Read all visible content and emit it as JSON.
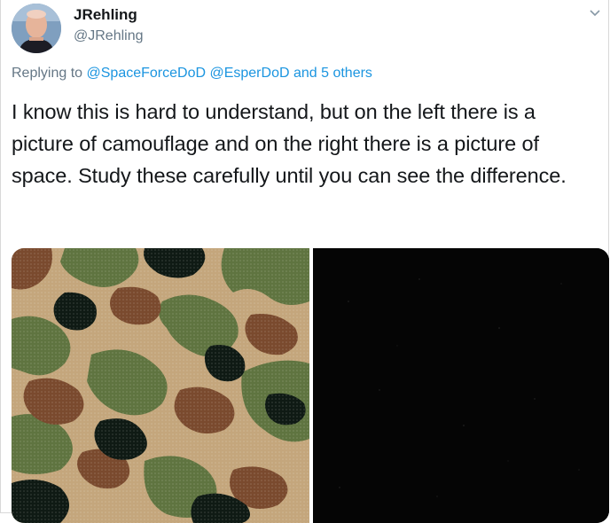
{
  "user": {
    "display_name": "JRehling",
    "handle": "@JRehling"
  },
  "menu": {
    "icon": "chevron-down-icon"
  },
  "reply_context": {
    "prefix": "Replying to ",
    "mention_1": "@SpaceForceDoD",
    "mention_2": "@EsperDoD",
    "others": "and 5 others"
  },
  "tweet": {
    "text": "I know this is hard to understand, but on the left there is a picture of camouflage and on the right there is a picture of space. Study these carefully until you can see the difference."
  },
  "media": {
    "left_image": "camouflage-image",
    "right_image": "space-image",
    "colors": {
      "camo_tan": "#c4a67c",
      "camo_green": "#5f7440",
      "camo_brown": "#7a4a2e",
      "camo_black": "#0f1a14",
      "space": "#050505"
    }
  },
  "colors": {
    "link": "#1b95e0",
    "secondary_text": "#657786",
    "text": "#14171a"
  }
}
